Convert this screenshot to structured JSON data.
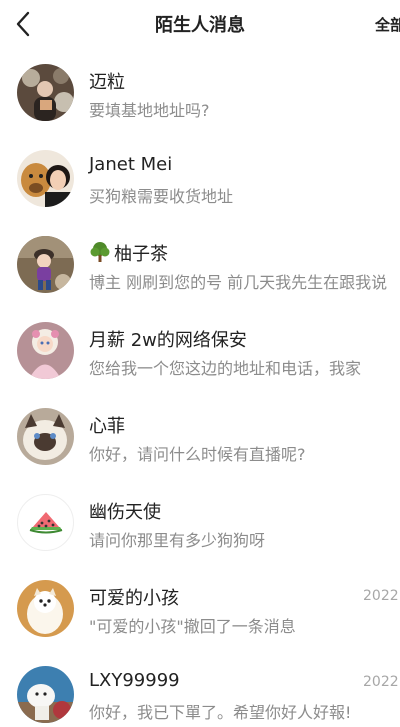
{
  "header": {
    "title": "陌生人消息",
    "right_action": "全部",
    "back_icon": "chevron-left-icon"
  },
  "messages": [
    {
      "name": "迈粒",
      "preview": "要填基地地址吗?",
      "date": "",
      "avatar": "avatar-photo"
    },
    {
      "name": "Janet Mei",
      "preview": "买狗粮需要收货地址",
      "date": "",
      "avatar": "avatar-photo"
    },
    {
      "name": "柚子茶",
      "preview": "博主 刚刷到您的号 前几天我先生在跟我说",
      "date": "",
      "avatar": "avatar-photo",
      "name_icon": "tree-emoji-icon"
    },
    {
      "name": "月薪 2w的网络保安",
      "preview": "您给我一个您这边的地址和电话，我家",
      "date": "",
      "avatar": "avatar-photo"
    },
    {
      "name": "心菲",
      "preview": "你好，请问什么时候有直播呢?",
      "date": "",
      "avatar": "avatar-photo"
    },
    {
      "name": "幽伤天使",
      "preview": "请问你那里有多少狗狗呀",
      "date": "",
      "avatar": "watermelon-icon"
    },
    {
      "name": "可爱的小孩",
      "preview": "\"可爱的小孩\"撤回了一条消息",
      "date": "2022",
      "avatar": "avatar-photo"
    },
    {
      "name": "LXY99999",
      "preview": "你好，我已下單了。希望你好人好報!",
      "date": "2022",
      "avatar": "avatar-photo"
    }
  ]
}
